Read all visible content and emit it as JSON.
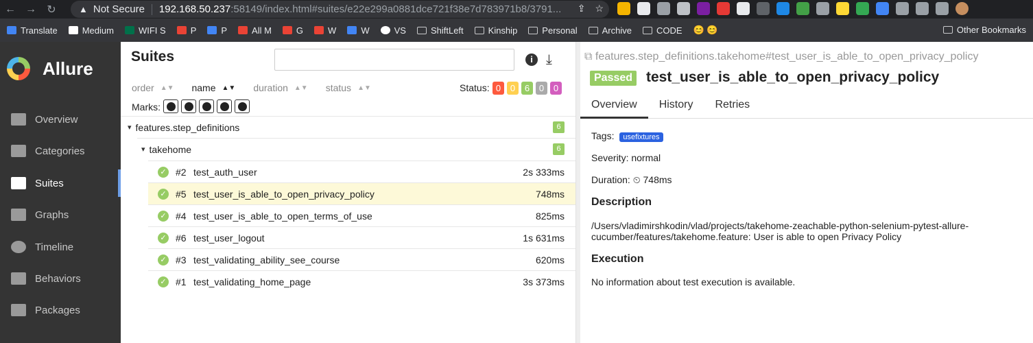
{
  "browser": {
    "security": "Not Secure",
    "url_host": "192.168.50.237",
    "url_path": ":58149/index.html#suites/e22e299a0881dce721f38e7d783971b8/3791...",
    "bookmarks": [
      "Translate",
      "Medium",
      "WIFI S",
      "P",
      "P",
      "All M",
      "G",
      "W",
      "W",
      "VS",
      "ShiftLeft",
      "Kinship",
      "Personal",
      "Archive",
      "CODE"
    ],
    "other_bookmarks": "Other Bookmarks"
  },
  "sidebar": {
    "brand": "Allure",
    "items": [
      {
        "label": "Overview",
        "icon": "home-icon"
      },
      {
        "label": "Categories",
        "icon": "flag-icon"
      },
      {
        "label": "Suites",
        "icon": "briefcase-icon"
      },
      {
        "label": "Graphs",
        "icon": "bar-chart-icon"
      },
      {
        "label": "Timeline",
        "icon": "clock-icon"
      },
      {
        "label": "Behaviors",
        "icon": "list-icon"
      },
      {
        "label": "Packages",
        "icon": "align-left-icon"
      }
    ]
  },
  "suites": {
    "title": "Suites",
    "sort": {
      "order": "order",
      "name": "name",
      "duration": "duration",
      "status": "status"
    },
    "status_label": "Status:",
    "status_counts": [
      "0",
      "0",
      "6",
      "0",
      "0"
    ],
    "status_colors": [
      "#fd5a3e",
      "#ffd050",
      "#97cc64",
      "#aaaaaa",
      "#d35ebe"
    ],
    "marks_label": "Marks:",
    "group1": {
      "name": "features.step_definitions",
      "count": "6"
    },
    "group2": {
      "name": "takehome",
      "count": "6"
    },
    "rows": [
      {
        "num": "#2",
        "name": "test_auth_user",
        "duration": "2s 333ms"
      },
      {
        "num": "#5",
        "name": "test_user_is_able_to_open_privacy_policy",
        "duration": "748ms"
      },
      {
        "num": "#4",
        "name": "test_user_is_able_to_open_terms_of_use",
        "duration": "825ms"
      },
      {
        "num": "#6",
        "name": "test_user_logout",
        "duration": "1s 631ms"
      },
      {
        "num": "#3",
        "name": "test_validating_ability_see_course",
        "duration": "620ms"
      },
      {
        "num": "#1",
        "name": "test_validating_home_page",
        "duration": "3s 373ms"
      }
    ]
  },
  "detail": {
    "path": "features.step_definitions.takehome#test_user_is_able_to_open_privacy_policy",
    "status": "Passed",
    "title": "test_user_is_able_to_open_privacy_policy",
    "tabs": [
      "Overview",
      "History",
      "Retries"
    ],
    "tags_label": "Tags:",
    "tag": "usefixtures",
    "severity": "Severity: normal",
    "duration": "Duration: ⏲ 748ms",
    "description_head": "Description",
    "description": "/Users/vladimirshkodin/vlad/projects/takehome-zeachable-python-selenium-pytest-allure-cucumber/features/takehome.feature: User is able to open Privacy Policy",
    "execution_head": "Execution",
    "execution": "No information about test execution is available."
  }
}
